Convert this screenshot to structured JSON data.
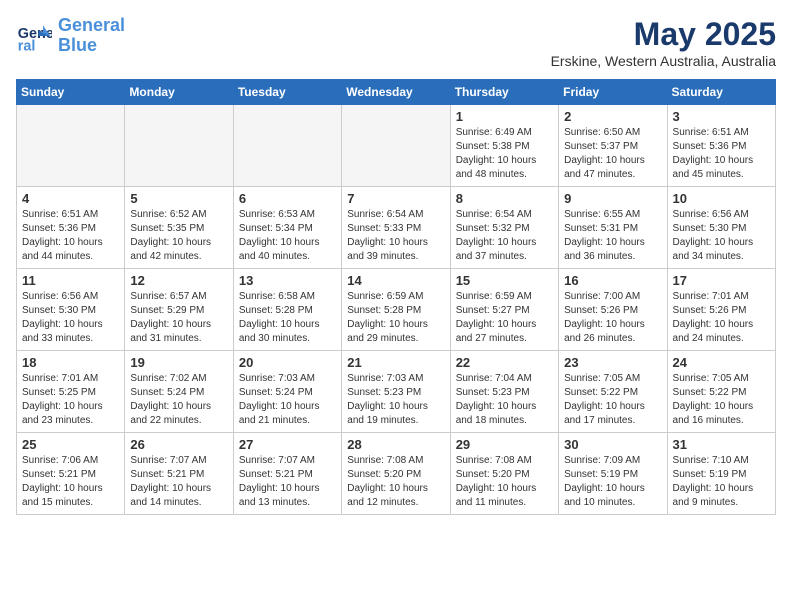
{
  "header": {
    "logo_line1": "General",
    "logo_line2": "Blue",
    "month_title": "May 2025",
    "location": "Erskine, Western Australia, Australia"
  },
  "days_of_week": [
    "Sunday",
    "Monday",
    "Tuesday",
    "Wednesday",
    "Thursday",
    "Friday",
    "Saturday"
  ],
  "weeks": [
    [
      {
        "day": "",
        "info": ""
      },
      {
        "day": "",
        "info": ""
      },
      {
        "day": "",
        "info": ""
      },
      {
        "day": "",
        "info": ""
      },
      {
        "day": "1",
        "info": "Sunrise: 6:49 AM\nSunset: 5:38 PM\nDaylight: 10 hours\nand 48 minutes."
      },
      {
        "day": "2",
        "info": "Sunrise: 6:50 AM\nSunset: 5:37 PM\nDaylight: 10 hours\nand 47 minutes."
      },
      {
        "day": "3",
        "info": "Sunrise: 6:51 AM\nSunset: 5:36 PM\nDaylight: 10 hours\nand 45 minutes."
      }
    ],
    [
      {
        "day": "4",
        "info": "Sunrise: 6:51 AM\nSunset: 5:36 PM\nDaylight: 10 hours\nand 44 minutes."
      },
      {
        "day": "5",
        "info": "Sunrise: 6:52 AM\nSunset: 5:35 PM\nDaylight: 10 hours\nand 42 minutes."
      },
      {
        "day": "6",
        "info": "Sunrise: 6:53 AM\nSunset: 5:34 PM\nDaylight: 10 hours\nand 40 minutes."
      },
      {
        "day": "7",
        "info": "Sunrise: 6:54 AM\nSunset: 5:33 PM\nDaylight: 10 hours\nand 39 minutes."
      },
      {
        "day": "8",
        "info": "Sunrise: 6:54 AM\nSunset: 5:32 PM\nDaylight: 10 hours\nand 37 minutes."
      },
      {
        "day": "9",
        "info": "Sunrise: 6:55 AM\nSunset: 5:31 PM\nDaylight: 10 hours\nand 36 minutes."
      },
      {
        "day": "10",
        "info": "Sunrise: 6:56 AM\nSunset: 5:30 PM\nDaylight: 10 hours\nand 34 minutes."
      }
    ],
    [
      {
        "day": "11",
        "info": "Sunrise: 6:56 AM\nSunset: 5:30 PM\nDaylight: 10 hours\nand 33 minutes."
      },
      {
        "day": "12",
        "info": "Sunrise: 6:57 AM\nSunset: 5:29 PM\nDaylight: 10 hours\nand 31 minutes."
      },
      {
        "day": "13",
        "info": "Sunrise: 6:58 AM\nSunset: 5:28 PM\nDaylight: 10 hours\nand 30 minutes."
      },
      {
        "day": "14",
        "info": "Sunrise: 6:59 AM\nSunset: 5:28 PM\nDaylight: 10 hours\nand 29 minutes."
      },
      {
        "day": "15",
        "info": "Sunrise: 6:59 AM\nSunset: 5:27 PM\nDaylight: 10 hours\nand 27 minutes."
      },
      {
        "day": "16",
        "info": "Sunrise: 7:00 AM\nSunset: 5:26 PM\nDaylight: 10 hours\nand 26 minutes."
      },
      {
        "day": "17",
        "info": "Sunrise: 7:01 AM\nSunset: 5:26 PM\nDaylight: 10 hours\nand 24 minutes."
      }
    ],
    [
      {
        "day": "18",
        "info": "Sunrise: 7:01 AM\nSunset: 5:25 PM\nDaylight: 10 hours\nand 23 minutes."
      },
      {
        "day": "19",
        "info": "Sunrise: 7:02 AM\nSunset: 5:24 PM\nDaylight: 10 hours\nand 22 minutes."
      },
      {
        "day": "20",
        "info": "Sunrise: 7:03 AM\nSunset: 5:24 PM\nDaylight: 10 hours\nand 21 minutes."
      },
      {
        "day": "21",
        "info": "Sunrise: 7:03 AM\nSunset: 5:23 PM\nDaylight: 10 hours\nand 19 minutes."
      },
      {
        "day": "22",
        "info": "Sunrise: 7:04 AM\nSunset: 5:23 PM\nDaylight: 10 hours\nand 18 minutes."
      },
      {
        "day": "23",
        "info": "Sunrise: 7:05 AM\nSunset: 5:22 PM\nDaylight: 10 hours\nand 17 minutes."
      },
      {
        "day": "24",
        "info": "Sunrise: 7:05 AM\nSunset: 5:22 PM\nDaylight: 10 hours\nand 16 minutes."
      }
    ],
    [
      {
        "day": "25",
        "info": "Sunrise: 7:06 AM\nSunset: 5:21 PM\nDaylight: 10 hours\nand 15 minutes."
      },
      {
        "day": "26",
        "info": "Sunrise: 7:07 AM\nSunset: 5:21 PM\nDaylight: 10 hours\nand 14 minutes."
      },
      {
        "day": "27",
        "info": "Sunrise: 7:07 AM\nSunset: 5:21 PM\nDaylight: 10 hours\nand 13 minutes."
      },
      {
        "day": "28",
        "info": "Sunrise: 7:08 AM\nSunset: 5:20 PM\nDaylight: 10 hours\nand 12 minutes."
      },
      {
        "day": "29",
        "info": "Sunrise: 7:08 AM\nSunset: 5:20 PM\nDaylight: 10 hours\nand 11 minutes."
      },
      {
        "day": "30",
        "info": "Sunrise: 7:09 AM\nSunset: 5:19 PM\nDaylight: 10 hours\nand 10 minutes."
      },
      {
        "day": "31",
        "info": "Sunrise: 7:10 AM\nSunset: 5:19 PM\nDaylight: 10 hours\nand 9 minutes."
      }
    ]
  ]
}
